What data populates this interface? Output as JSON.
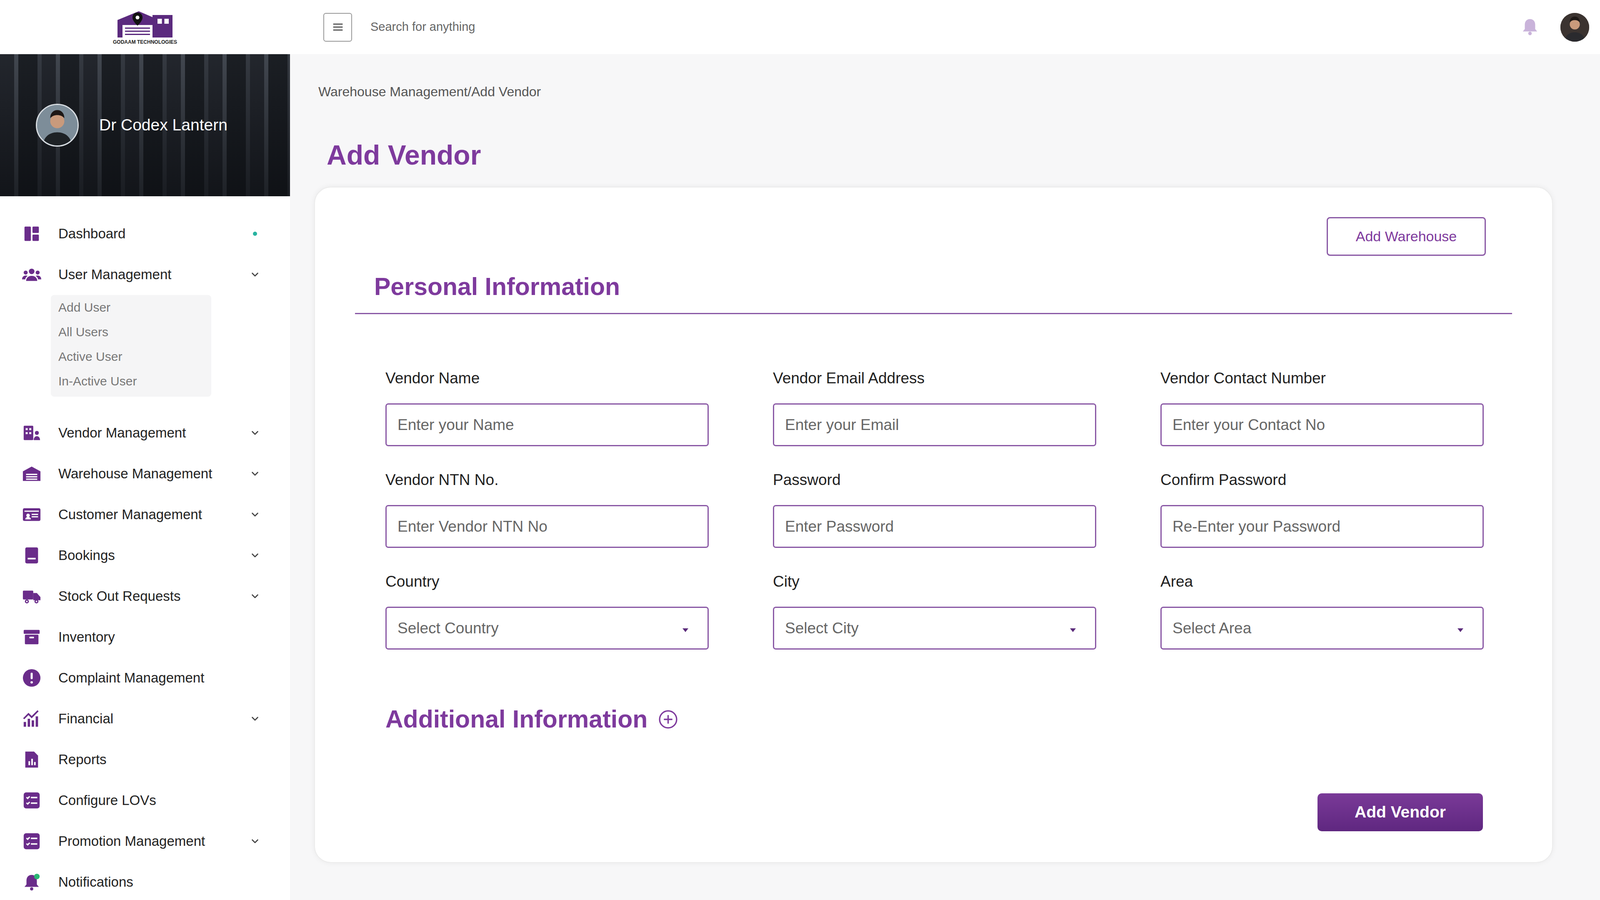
{
  "logo": {
    "text": "GODAAM TECHNOLOGIES"
  },
  "search": {
    "placeholder": "Search for anything"
  },
  "profile": {
    "name": "Dr Codex Lantern"
  },
  "sidebar": {
    "items": [
      {
        "label": "Dashboard",
        "selected": true,
        "has_submenu": false,
        "expanded": false,
        "children": []
      },
      {
        "label": "User Management",
        "selected": false,
        "has_submenu": true,
        "expanded": true,
        "children": [
          "Add User",
          "All Users",
          "Active User",
          "In-Active User"
        ]
      },
      {
        "label": "Vendor Management",
        "selected": false,
        "has_submenu": true,
        "expanded": false,
        "children": []
      },
      {
        "label": "Warehouse Management",
        "selected": false,
        "has_submenu": true,
        "expanded": false,
        "children": []
      },
      {
        "label": "Customer Management",
        "selected": false,
        "has_submenu": true,
        "expanded": false,
        "children": []
      },
      {
        "label": "Bookings",
        "selected": false,
        "has_submenu": true,
        "expanded": false,
        "children": []
      },
      {
        "label": "Stock Out Requests",
        "selected": false,
        "has_submenu": true,
        "expanded": false,
        "children": []
      },
      {
        "label": "Inventory",
        "selected": false,
        "has_submenu": false,
        "expanded": false,
        "children": []
      },
      {
        "label": "Complaint Management",
        "selected": false,
        "has_submenu": false,
        "expanded": false,
        "children": []
      },
      {
        "label": "Financial",
        "selected": false,
        "has_submenu": true,
        "expanded": false,
        "children": []
      },
      {
        "label": "Reports",
        "selected": false,
        "has_submenu": false,
        "expanded": false,
        "children": []
      },
      {
        "label": "Configure LOVs",
        "selected": false,
        "has_submenu": false,
        "expanded": false,
        "children": []
      },
      {
        "label": "Promotion Management",
        "selected": false,
        "has_submenu": true,
        "expanded": false,
        "children": []
      },
      {
        "label": "Notifications",
        "selected": false,
        "has_submenu": false,
        "expanded": false,
        "children": []
      }
    ]
  },
  "breadcrumb": "Warehouse Management/Add Vendor",
  "page": {
    "title": "Add Vendor"
  },
  "form": {
    "top_button": "Add Warehouse",
    "section_title": "Personal Information",
    "fields": [
      {
        "label": "Vendor Name",
        "placeholder": "Enter your Name",
        "kind": "text"
      },
      {
        "label": "Vendor Email Address",
        "placeholder": "Enter your Email",
        "kind": "text"
      },
      {
        "label": "Vendor Contact Number",
        "placeholder": "Enter your Contact No",
        "kind": "text"
      },
      {
        "label": "Vendor NTN No.",
        "placeholder": "Enter Vendor NTN No",
        "kind": "text"
      },
      {
        "label": "Password",
        "placeholder": "Enter Password",
        "kind": "password"
      },
      {
        "label": "Confirm Password",
        "placeholder": "Re-Enter your Password",
        "kind": "password"
      },
      {
        "label": "Country",
        "placeholder": "Select Country",
        "kind": "select"
      },
      {
        "label": "City",
        "placeholder": "Select City",
        "kind": "select"
      },
      {
        "label": "Area",
        "placeholder": "Select Area",
        "kind": "select"
      }
    ],
    "additional": {
      "label": "Additional Information",
      "expanded": false
    },
    "submit": "Add Vendor"
  }
}
